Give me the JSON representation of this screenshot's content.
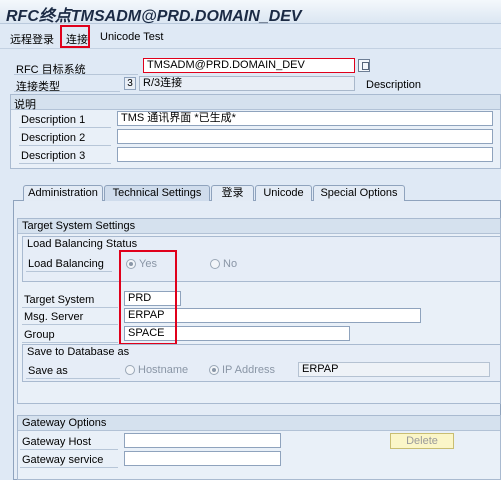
{
  "window": {
    "title": "RFC终点TMSADM@PRD.DOMAIN_DEV"
  },
  "menu": {
    "items": [
      "远程登录",
      "连接",
      "Unicode Test"
    ]
  },
  "header": {
    "rfc_dest_label": "RFC 目标系统",
    "rfc_dest_value": "TMSADM@PRD.DOMAIN_DEV",
    "conn_type_label": "连接类型",
    "conn_type_code": "3",
    "conn_type_value": "R/3连接",
    "description_label": "Description"
  },
  "description_section": {
    "title": "说明",
    "rows": [
      {
        "label": "Description 1",
        "value": "TMS 通讯界面  *已生成*"
      },
      {
        "label": "Description 2",
        "value": ""
      },
      {
        "label": "Description 3",
        "value": ""
      }
    ]
  },
  "tabs": [
    "Administration",
    "Technical Settings",
    "登录",
    "Unicode",
    "Special Options"
  ],
  "active_tab": "Technical Settings",
  "target_system_settings": {
    "title": "Target System Settings",
    "load_balancing_status": {
      "title": "Load Balancing Status",
      "label": "Load Balancing",
      "yes_label": "Yes",
      "no_label": "No",
      "selected": "Yes"
    },
    "target_system_label": "Target System",
    "target_system_value": "PRD",
    "msg_server_label": "Msg. Server",
    "msg_server_value": "ERPAP",
    "group_label": "Group",
    "group_value": "SPACE",
    "save_to_db": {
      "title": "Save to Database as",
      "label": "Save as",
      "hostname_label": "Hostname",
      "ip_label": "IP Address",
      "selected": "IP Address",
      "value": "ERPAP"
    }
  },
  "gateway_options": {
    "title": "Gateway Options",
    "host_label": "Gateway Host",
    "host_value": "",
    "service_label": "Gateway service",
    "service_value": "",
    "delete_label": "Delete"
  },
  "colors": {
    "highlight": "#e0001b",
    "background": "#dfe9f5",
    "delete_button": "#fbf6c8"
  }
}
